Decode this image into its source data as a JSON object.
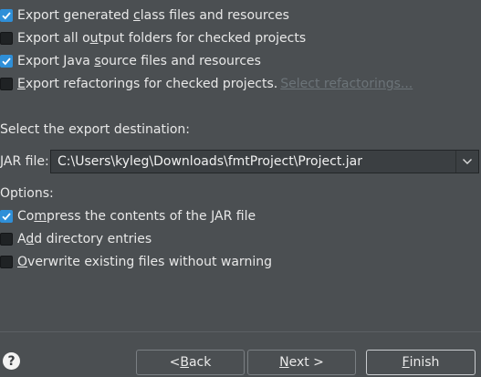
{
  "checkboxes": [
    {
      "pre": "Export generated ",
      "mn": "c",
      "post": "lass files and resources",
      "checked": true
    },
    {
      "pre": "Export all o",
      "mn": "u",
      "post": "tput folders for checked projects",
      "checked": false
    },
    {
      "pre": "Export Java ",
      "mn": "s",
      "post": "ource files and resources",
      "checked": true
    },
    {
      "pre": "",
      "mn": "E",
      "post": "xport refactorings for checked projects.",
      "checked": false,
      "link": "Select refactorings..."
    }
  ],
  "destination_label": "Select the export destination:",
  "jar": {
    "label": "JAR file:",
    "value": "C:\\Users\\kyleg\\Downloads\\fmtProject\\Project.jar"
  },
  "options_label": "Options:",
  "options": [
    {
      "pre": "Co",
      "mn": "m",
      "post": "press the contents of the JAR file",
      "checked": true
    },
    {
      "pre": "A",
      "mn": "d",
      "post": "d directory entries",
      "checked": false
    },
    {
      "pre": "",
      "mn": "O",
      "post": "verwrite existing files without warning",
      "checked": false
    }
  ],
  "buttons": {
    "back_pre": "< ",
    "back_mn": "B",
    "back_post": "ack",
    "next_pre": "",
    "next_mn": "N",
    "next_post": "ext >",
    "finish_pre": "",
    "finish_mn": "F",
    "finish_post": "inish"
  },
  "help": {
    "glyph": "?"
  },
  "colors": {
    "background": "#4b4f52",
    "checkbox_checked": "#2f8fd8",
    "link_disabled": "#6c7479"
  }
}
